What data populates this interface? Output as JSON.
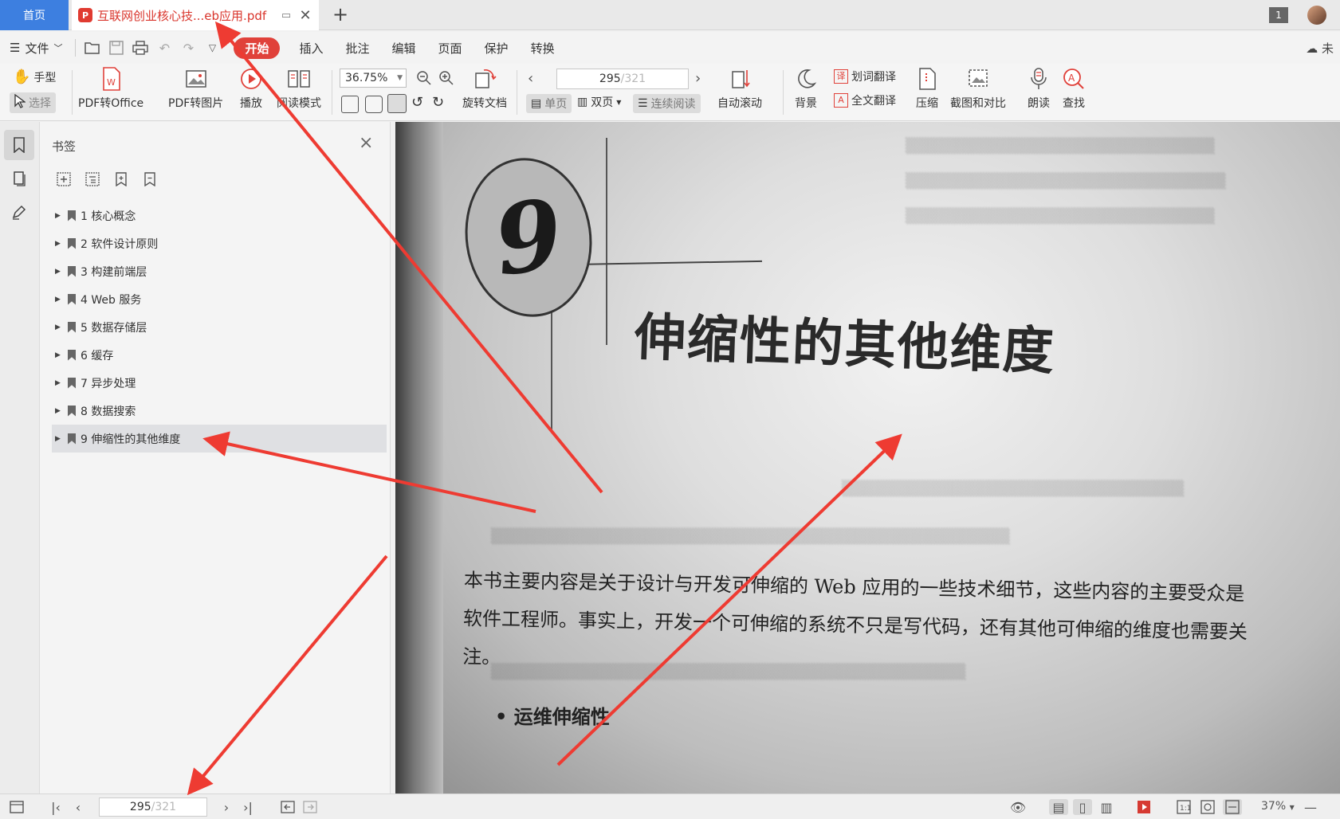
{
  "tabs": {
    "home_label": "首页",
    "doc_title": "互联网创业核心技...eb应用.pdf",
    "window_count": "1"
  },
  "menu": {
    "file_label": "文件",
    "items": [
      "开始",
      "插入",
      "批注",
      "编辑",
      "页面",
      "保护",
      "转换"
    ],
    "cloud_label": "未"
  },
  "ribbon": {
    "hand_label": "手型",
    "select_label": "选择",
    "pdf_to_office": "PDF转Office",
    "pdf_to_image": "PDF转图片",
    "play_label": "播放",
    "read_mode": "阅读模式",
    "zoom_value": "36.75%",
    "rotate_doc": "旋转文档",
    "current_page": "295",
    "total_pages": "/321",
    "single_page": "单页",
    "double_page": "双页",
    "continuous": "连续阅读",
    "auto_scroll": "自动滚动",
    "background": "背景",
    "word_translate": "划词翻译",
    "full_translate": "全文翻译",
    "compress": "压缩",
    "screenshot_compare": "截图和对比",
    "read_aloud": "朗读",
    "find": "查找"
  },
  "panel": {
    "title": "书签",
    "bookmarks": [
      "1 核心概念",
      "2 软件设计原则",
      "3 构建前端层",
      "4 Web 服务",
      "5 数据存储层",
      "6 缓存",
      "7 异步处理",
      "8 数据搜索",
      "9 伸缩性的其他维度"
    ]
  },
  "document": {
    "chapter_number": "9",
    "chapter_title": "伸缩性的其他维度",
    "paragraph": "本书主要内容是关于设计与开发可伸缩的 Web 应用的一些技术细节，这些内容的主要受众是软件工程师。事实上，开发一个可伸缩的系统不只是写代码，还有其他可伸缩的维度也需要关注。",
    "bullet": "运维伸缩性"
  },
  "statusbar": {
    "current_page": "295",
    "total_pages": "/321",
    "zoom": "37%"
  },
  "colors": {
    "accent_red": "#e0413a",
    "home_tab_blue": "#3d7fe0",
    "annotation_red": "#ee3b32"
  }
}
